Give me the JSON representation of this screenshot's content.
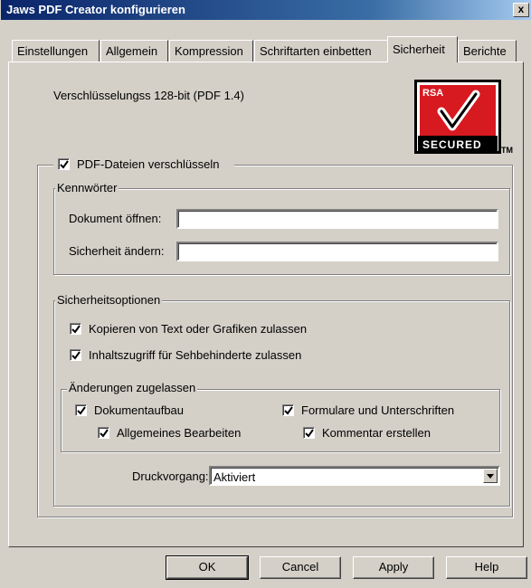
{
  "window": {
    "title": "Jaws PDF Creator konfigurieren",
    "close_label": "x"
  },
  "tabs": [
    {
      "label": "Einstellungen",
      "active": false
    },
    {
      "label": "Allgemein",
      "active": false
    },
    {
      "label": "Kompression",
      "active": false
    },
    {
      "label": "Schriftarten einbetten",
      "active": false
    },
    {
      "label": "Sicherheit",
      "active": true
    },
    {
      "label": "Berichte",
      "active": false
    }
  ],
  "security": {
    "encryption_info": "Verschlüsselungss 128-bit (PDF 1.4)",
    "logo": {
      "brand": "RSA",
      "text": "SECURED",
      "tm": "TM"
    },
    "encrypt_checkbox": {
      "label": "PDF-Dateien verschlüsseln",
      "checked": true
    },
    "passwords": {
      "legend": "Kennwörter",
      "open_label": "Dokument öffnen:",
      "open_value": "",
      "change_label": "Sicherheit ändern:",
      "change_value": ""
    },
    "options": {
      "legend": "Sicherheitsoptionen",
      "copy": {
        "label": "Kopieren von Text oder Grafiken zulassen",
        "checked": true
      },
      "accessibility": {
        "label": "Inhaltszugriff für Sehbehinderte zulassen",
        "checked": true
      },
      "changes": {
        "legend": "Änderungen zugelassen",
        "document_assembly": {
          "label": "Dokumentaufbau",
          "checked": true
        },
        "forms_signatures": {
          "label": "Formulare und Unterschriften",
          "checked": true
        },
        "general_editing": {
          "label": "Allgemeines Bearbeiten",
          "checked": true
        },
        "comments": {
          "label": "Kommentar erstellen",
          "checked": true
        }
      },
      "print": {
        "label": "Druckvorgang:",
        "value": "Aktiviert"
      }
    }
  },
  "buttons": {
    "ok": "OK",
    "cancel": "Cancel",
    "apply": "Apply",
    "help": "Help"
  }
}
